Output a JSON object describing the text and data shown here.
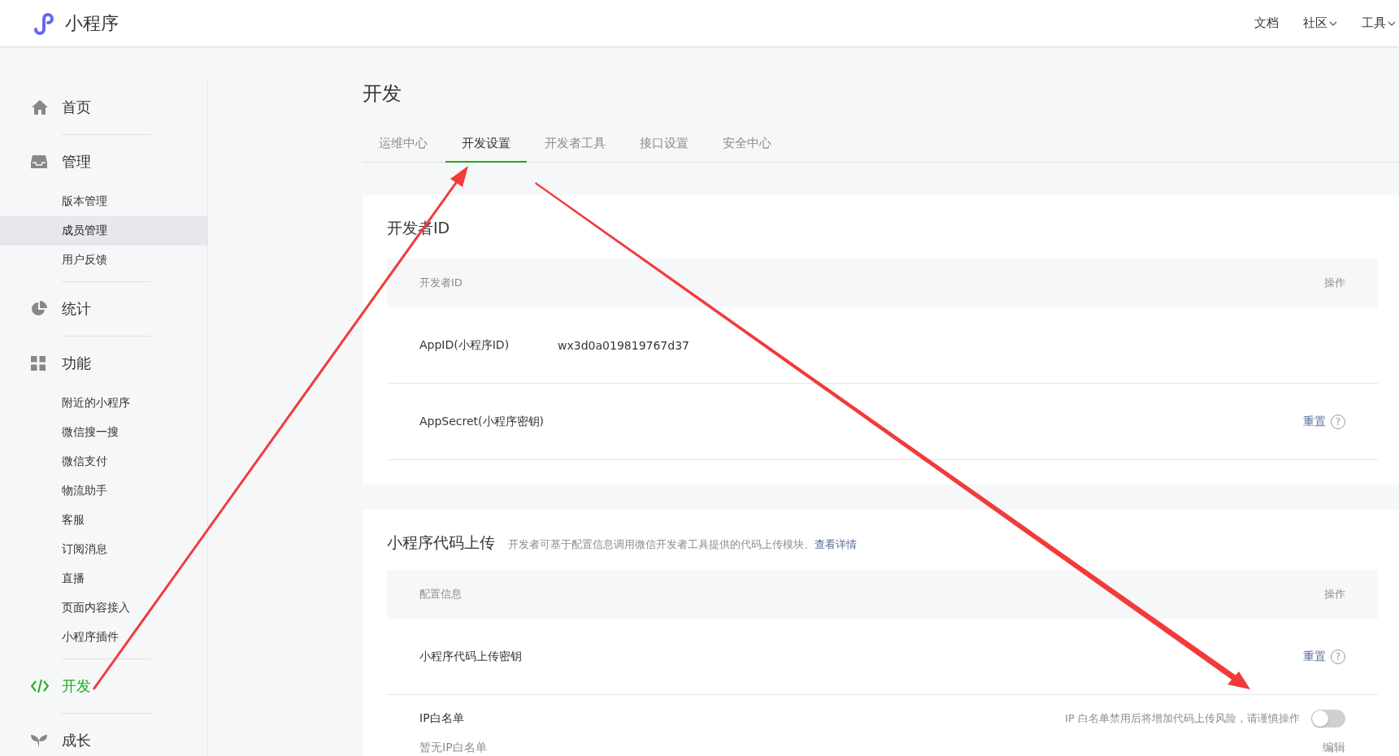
{
  "header": {
    "logo_text": "小程序",
    "nav": [
      {
        "label": "文档",
        "dropdown": false
      },
      {
        "label": "社区",
        "dropdown": true
      },
      {
        "label": "工具",
        "dropdown": true
      }
    ]
  },
  "sidebar": {
    "groups": [
      {
        "label": "首页",
        "selected": false
      },
      {
        "label": "管理",
        "selected": false,
        "children": [
          {
            "label": "版本管理",
            "selected": false
          },
          {
            "label": "成员管理",
            "selected": true
          },
          {
            "label": "用户反馈",
            "selected": false
          }
        ]
      },
      {
        "label": "统计",
        "selected": false
      },
      {
        "label": "功能",
        "selected": false,
        "children": [
          {
            "label": "附近的小程序",
            "selected": false
          },
          {
            "label": "微信搜一搜",
            "selected": false
          },
          {
            "label": "微信支付",
            "selected": false
          },
          {
            "label": "物流助手",
            "selected": false
          },
          {
            "label": "客服",
            "selected": false
          },
          {
            "label": "订阅消息",
            "selected": false
          },
          {
            "label": "直播",
            "selected": false
          },
          {
            "label": "页面内容接入",
            "selected": false
          },
          {
            "label": "小程序插件",
            "selected": false
          }
        ]
      },
      {
        "label": "开发",
        "selected": true
      },
      {
        "label": "成长",
        "selected": false
      }
    ]
  },
  "page_title": "开发",
  "tabs": [
    {
      "label": "运维中心",
      "selected": false
    },
    {
      "label": "开发设置",
      "selected": true
    },
    {
      "label": "开发者工具",
      "selected": false
    },
    {
      "label": "接口设置",
      "selected": false
    },
    {
      "label": "安全中心",
      "selected": false
    }
  ],
  "developer_id": {
    "title": "开发者ID",
    "columns": [
      "开发者ID",
      "操作"
    ],
    "rows": [
      {
        "label": "AppID(小程序ID)",
        "value": "wx3d0a019819767d37"
      },
      {
        "label": "AppSecret(小程序密钥)",
        "action": "重置",
        "help": "?"
      }
    ]
  },
  "code_upload": {
    "title": "小程序代码上传",
    "description": "开发者可基于配置信息调用微信开发者工具提供的代码上传模块。",
    "link": "查看详情",
    "columns": [
      "配置信息",
      "操作"
    ],
    "rows": [
      {
        "label": "小程序代码上传密钥",
        "action": "重置",
        "help": "?"
      }
    ],
    "ip_whitelist": {
      "label": "IP白名单",
      "warning": "IP 白名单禁用后将增加代码上传风险，请谨慎操作",
      "on": false,
      "empty_text": "暂无IP白名单",
      "action": "编辑"
    }
  }
}
